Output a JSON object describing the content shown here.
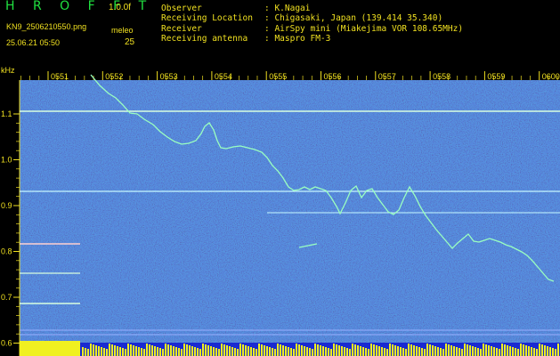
{
  "header": {
    "brand": "H R O F F T",
    "version": "1.0.0f",
    "filename": "KN9_2506210550.png",
    "meleo_label": "meleo",
    "datetime": "25.06.21 05:50",
    "meleo_value": "25"
  },
  "info": [
    {
      "key": "Observer",
      "value": ": K.Nagai"
    },
    {
      "key": "Receiving Location",
      "value": ": Chigasaki, Japan (139.414 35.340)"
    },
    {
      "key": "Receiver",
      "value": ": AirSpy mini (Miakejima VOR 108.65MHz)"
    },
    {
      "key": "Receiving antenna",
      "value": ": Maspro FM-3"
    }
  ],
  "spectrogram": {
    "y_unit": "kHz",
    "y_ticks": [
      "1.1",
      "1.0",
      "0.9",
      "0.8",
      "0.7",
      "0.6"
    ],
    "x_ticks": [
      "0551",
      "0552",
      "0553",
      "0554",
      "0555",
      "0556",
      "0557",
      "0558",
      "0559",
      "0600"
    ],
    "colors": {
      "background": "#1a2a8a",
      "signal": "#7fffb0",
      "label": "#f0e020",
      "grid": "#f0e020"
    }
  }
}
